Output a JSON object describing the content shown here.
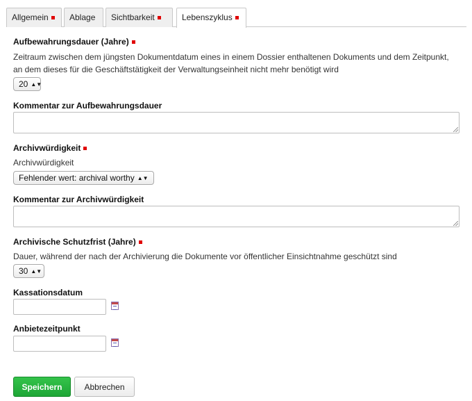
{
  "tabs": [
    {
      "label": "Allgemein",
      "required": true,
      "active": false
    },
    {
      "label": "Ablage",
      "required": false,
      "active": false
    },
    {
      "label": "Sichtbarkeit",
      "required": true,
      "active": false
    },
    {
      "label": "Lebenszyklus",
      "required": true,
      "active": true
    }
  ],
  "retention": {
    "label": "Aufbewahrungsdauer (Jahre)",
    "help_line1": "Zeitraum zwischen dem jüngsten Dokumentdatum eines in einem Dossier enthaltenen Dokuments und dem Zeitpunkt,",
    "help_line2": "an dem dieses für die Geschäftstätigkeit der Verwaltungseinheit nicht mehr benötigt wird",
    "value": "20"
  },
  "retention_comment": {
    "label": "Kommentar zur Aufbewahrungsdauer",
    "value": ""
  },
  "archival": {
    "label": "Archivwürdigkeit",
    "help": "Archivwürdigkeit",
    "value": "Fehlender wert: archival worthy"
  },
  "archival_comment": {
    "label": "Kommentar zur Archivwürdigkeit",
    "value": ""
  },
  "protection": {
    "label": "Archivische Schutzfrist (Jahre)",
    "help": "Dauer, während der nach der Archivierung die Dokumente vor öffentlicher Einsichtnahme geschützt sind",
    "value": "30"
  },
  "cassation": {
    "label": "Kassationsdatum",
    "value": ""
  },
  "offer": {
    "label": "Anbietezeitpunkt",
    "value": ""
  },
  "buttons": {
    "save": "Speichern",
    "cancel": "Abbrechen"
  },
  "colors": {
    "required_marker": "#e00000",
    "save_button": "#2db443"
  }
}
